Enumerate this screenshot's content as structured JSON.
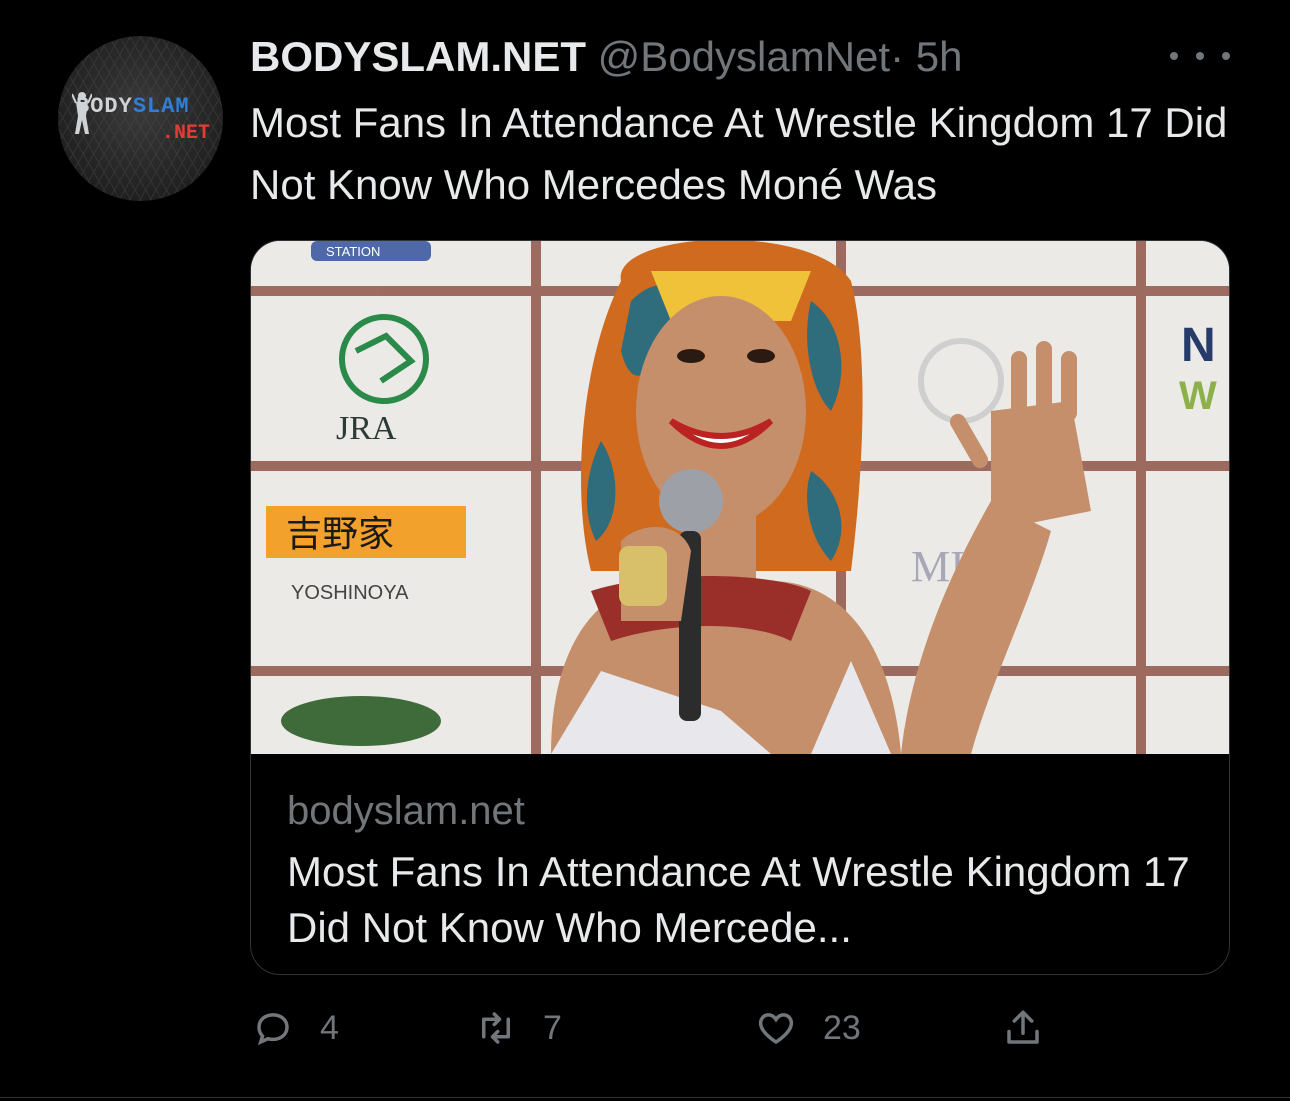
{
  "tweet": {
    "author_name": "BODYSLAM.NET",
    "handle": "@BodyslamNet",
    "separator": "·",
    "time": "5h",
    "text": "Most Fans In Attendance At Wrestle Kingdom 17 Did Not Know Who Mercedes Moné Was"
  },
  "avatar": {
    "logo_line1_a": "BODY",
    "logo_line1_b": "SLAM",
    "logo_line2": ".NET"
  },
  "card": {
    "domain": "bodyslam.net",
    "title": "Most Fans In Attendance At Wrestle Kingdom 17 Did Not Know Who Mercede...",
    "image": {
      "sponsor_jra": "JRA",
      "sponsor_yoshinoya": "YOSHINOYA",
      "sponsor_yoshinoya_kanji": "吉野家",
      "sponsor_mica": "MICA",
      "sponsor_n": "N",
      "sponsor_w": "W",
      "banner_top": "STATION"
    }
  },
  "actions": {
    "replies": "4",
    "retweets": "7",
    "likes": "23"
  },
  "icons": [
    "more-icon",
    "reply-icon",
    "retweet-icon",
    "like-icon",
    "share-icon"
  ],
  "colors": {
    "background": "#000000",
    "text": "#e7e9ea",
    "muted": "#71767b",
    "border": "#2f3336"
  }
}
